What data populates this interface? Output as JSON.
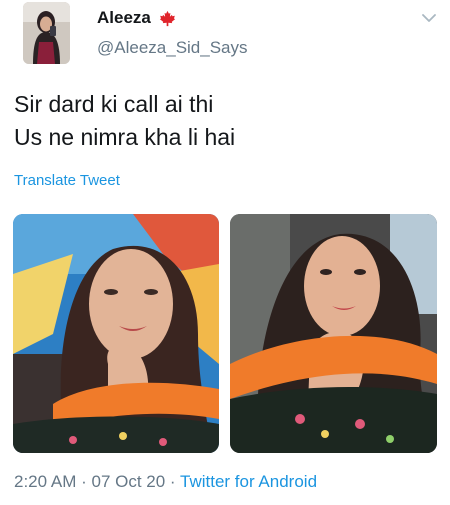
{
  "user": {
    "display_name": "Aleeza",
    "handle": "@Aleeza_Sid_Says",
    "flag_icon": "maple-leaf-icon"
  },
  "tweet": {
    "lines": [
      "Sir dard ki call ai thi",
      "Us ne nimra kha li hai"
    ],
    "translate_label": "Translate Tweet"
  },
  "meta": {
    "time": "2:20 AM",
    "separator": " · ",
    "date": "07 Oct 20",
    "source": "Twitter for Android"
  },
  "colors": {
    "link": "#1b95e0",
    "secondary_text": "#657786",
    "primary_text": "#14171a",
    "flag_red": "#e0242b"
  }
}
